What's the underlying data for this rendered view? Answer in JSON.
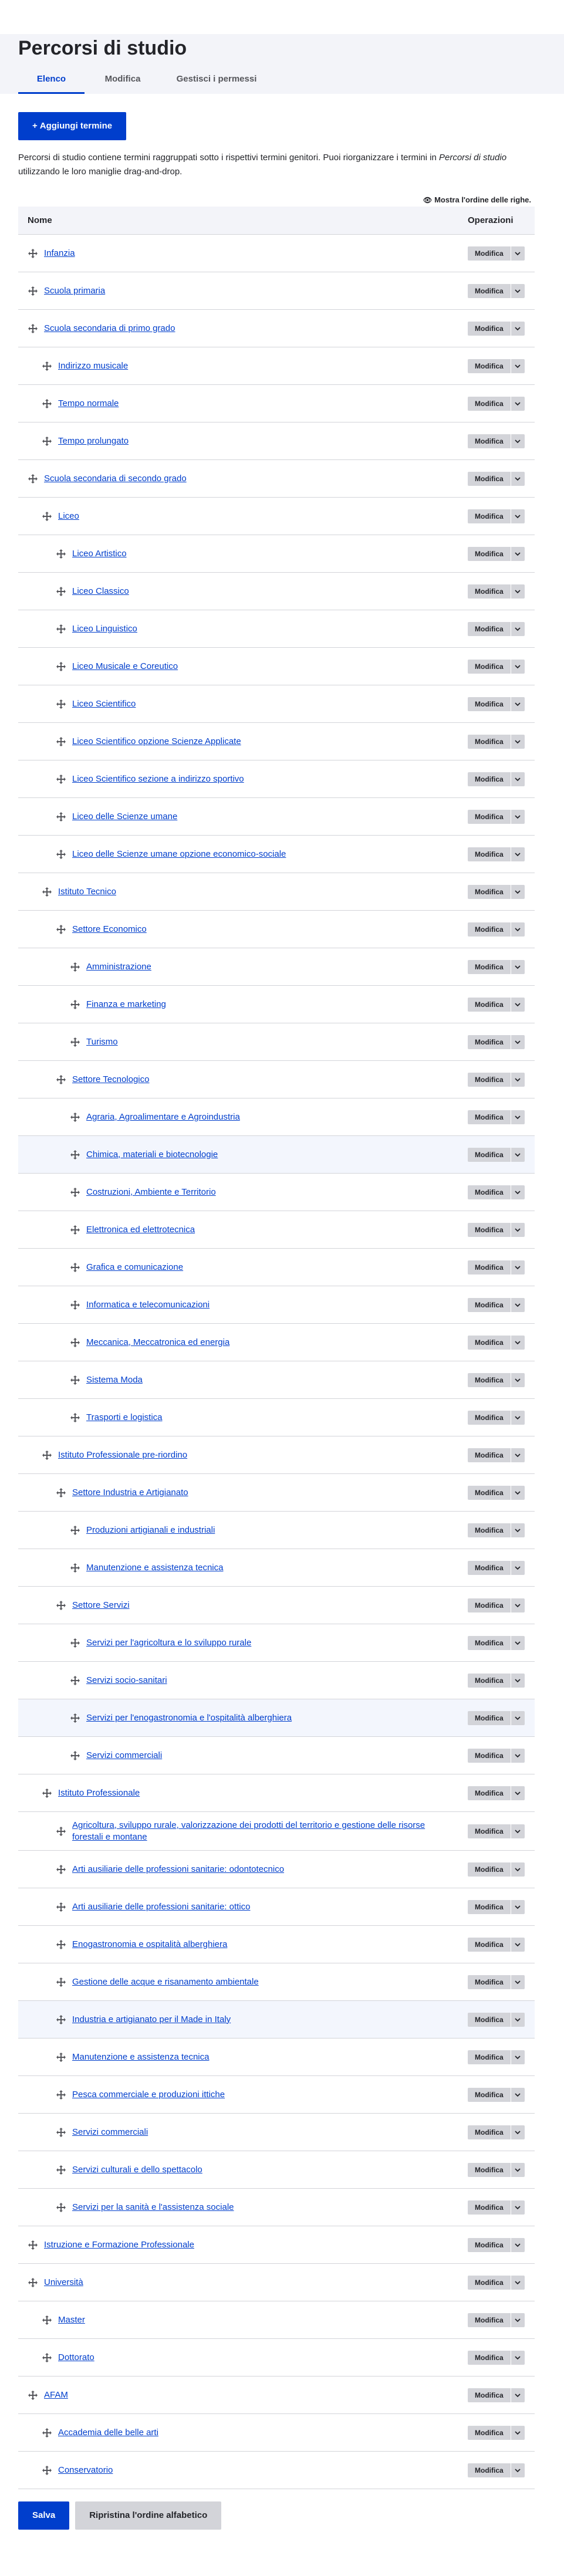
{
  "page": {
    "title": "Percorsi di studio",
    "tabs": [
      {
        "label": "Elenco",
        "active": true
      },
      {
        "label": "Modifica",
        "active": false
      },
      {
        "label": "Gestisci i permessi",
        "active": false
      }
    ],
    "add_button": "Aggiungi termine",
    "description_before": "Percorsi di studio contiene termini raggruppati sotto i rispettivi termini genitori. Puoi riorganizzare i termini in ",
    "description_em": "Percorsi di studio",
    "description_after": " utilizzando le loro maniglie drag-and-drop.",
    "show_order_toggle": "Mostra l'ordine delle righe.",
    "colors": {
      "accent": "#003ecc",
      "header_bg": "#f3f4f9",
      "button_grey": "#d3d4d9",
      "highlight_row": "#f3f6fd"
    }
  },
  "table": {
    "headers": {
      "name": "Nome",
      "operations": "Operazioni"
    },
    "op_label": "Modifica",
    "rows": [
      {
        "name": "Infanzia",
        "depth": 0
      },
      {
        "name": "Scuola primaria",
        "depth": 0
      },
      {
        "name": "Scuola secondaria di primo grado",
        "depth": 0
      },
      {
        "name": "Indirizzo musicale",
        "depth": 1
      },
      {
        "name": "Tempo normale",
        "depth": 1
      },
      {
        "name": "Tempo prolungato",
        "depth": 1
      },
      {
        "name": "Scuola secondaria di secondo grado",
        "depth": 0
      },
      {
        "name": "Liceo",
        "depth": 1
      },
      {
        "name": "Liceo Artistico",
        "depth": 2
      },
      {
        "name": "Liceo Classico",
        "depth": 2
      },
      {
        "name": "Liceo Linguistico",
        "depth": 2
      },
      {
        "name": "Liceo Musicale e Coreutico",
        "depth": 2
      },
      {
        "name": "Liceo Scientifico",
        "depth": 2
      },
      {
        "name": "Liceo Scientifico opzione Scienze Applicate",
        "depth": 2
      },
      {
        "name": "Liceo Scientifico sezione a indirizzo sportivo",
        "depth": 2
      },
      {
        "name": "Liceo delle Scienze umane",
        "depth": 2
      },
      {
        "name": "Liceo delle Scienze umane opzione economico-sociale",
        "depth": 2
      },
      {
        "name": "Istituto Tecnico",
        "depth": 1
      },
      {
        "name": "Settore Economico",
        "depth": 2
      },
      {
        "name": "Amministrazione",
        "depth": 3
      },
      {
        "name": "Finanza e marketing",
        "depth": 3
      },
      {
        "name": "Turismo",
        "depth": 3
      },
      {
        "name": "Settore Tecnologico",
        "depth": 2
      },
      {
        "name": "Agraria, Agroalimentare e Agroindustria",
        "depth": 3
      },
      {
        "name": "Chimica, materiali e biotecnologie",
        "depth": 3,
        "highlight": true
      },
      {
        "name": "Costruzioni, Ambiente e Territorio",
        "depth": 3
      },
      {
        "name": "Elettronica ed elettrotecnica",
        "depth": 3
      },
      {
        "name": "Grafica e comunicazione",
        "depth": 3
      },
      {
        "name": "Informatica e telecomunicazioni",
        "depth": 3
      },
      {
        "name": "Meccanica, Meccatronica ed energia",
        "depth": 3
      },
      {
        "name": "Sistema Moda",
        "depth": 3
      },
      {
        "name": "Trasporti e logistica",
        "depth": 3
      },
      {
        "name": "Istituto Professionale pre-riordino",
        "depth": 1
      },
      {
        "name": "Settore Industria e Artigianato",
        "depth": 2
      },
      {
        "name": "Produzioni artigianali e industriali",
        "depth": 3
      },
      {
        "name": "Manutenzione e assistenza tecnica",
        "depth": 3
      },
      {
        "name": "Settore Servizi",
        "depth": 2
      },
      {
        "name": "Servizi per l'agricoltura e lo sviluppo rurale",
        "depth": 3
      },
      {
        "name": "Servizi socio-sanitari",
        "depth": 3
      },
      {
        "name": "Servizi per l'enogastronomia e l'ospitalità alberghiera",
        "depth": 3,
        "highlight": true
      },
      {
        "name": "Servizi commerciali",
        "depth": 3
      },
      {
        "name": "Istituto Professionale",
        "depth": 1
      },
      {
        "name": "Agricoltura, sviluppo rurale, valorizzazione dei prodotti del territorio e gestione delle risorse forestali e montane",
        "depth": 2,
        "tall": true
      },
      {
        "name": "Arti ausiliarie delle professioni sanitarie: odontotecnico",
        "depth": 2
      },
      {
        "name": "Arti ausiliarie delle professioni sanitarie: ottico",
        "depth": 2
      },
      {
        "name": "Enogastronomia e ospitalità alberghiera",
        "depth": 2
      },
      {
        "name": "Gestione delle acque e risanamento ambientale",
        "depth": 2
      },
      {
        "name": "Industria e artigianato per il Made in Italy",
        "depth": 2,
        "highlight": true
      },
      {
        "name": "Manutenzione e assistenza tecnica",
        "depth": 2
      },
      {
        "name": "Pesca commerciale e produzioni ittiche",
        "depth": 2
      },
      {
        "name": "Servizi commerciali",
        "depth": 2
      },
      {
        "name": "Servizi culturali e dello spettacolo",
        "depth": 2
      },
      {
        "name": "Servizi per la sanità e l'assistenza sociale",
        "depth": 2
      },
      {
        "name": "Istruzione e Formazione Professionale",
        "depth": 0
      },
      {
        "name": "Università",
        "depth": 0
      },
      {
        "name": "Master",
        "depth": 1
      },
      {
        "name": "Dottorato",
        "depth": 1
      },
      {
        "name": "AFAM",
        "depth": 0
      },
      {
        "name": "Accademia delle belle arti",
        "depth": 1
      },
      {
        "name": "Conservatorio",
        "depth": 1
      }
    ]
  },
  "actions": {
    "save": "Salva",
    "reset": "Ripristina l'ordine alfabetico"
  }
}
